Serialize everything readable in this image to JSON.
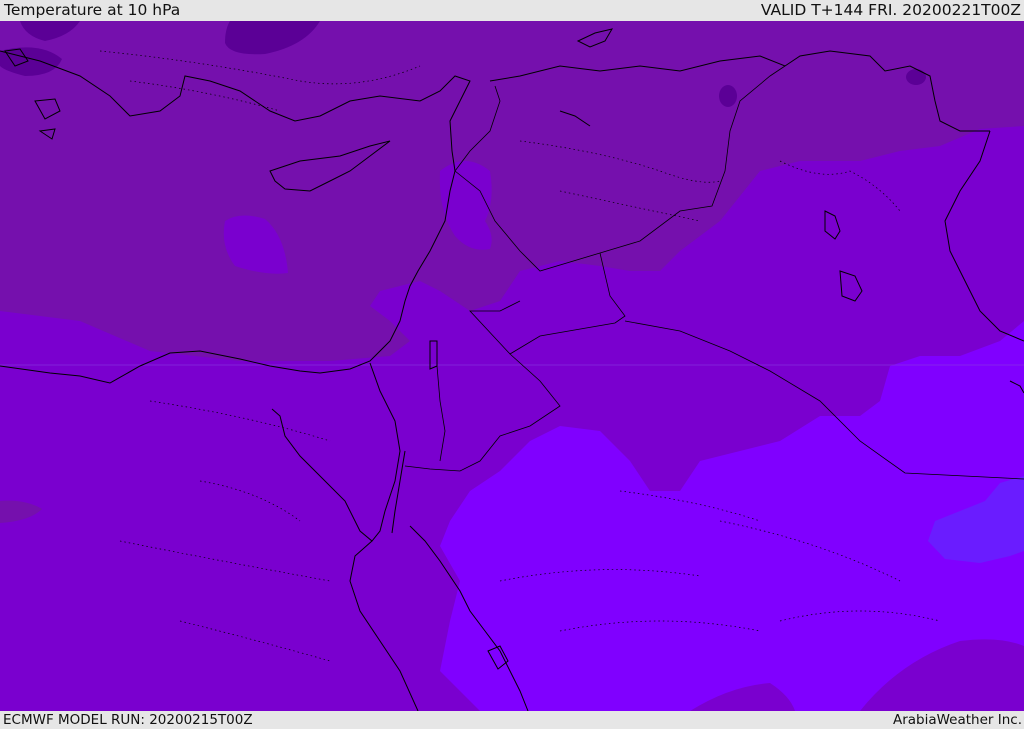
{
  "header": {
    "title": "Temperature at 10 hPa",
    "valid_time": "VALID T+144 FRI. 20200221T00Z"
  },
  "footer": {
    "model_run": "ECMWF MODEL RUN: 20200215T00Z",
    "credit": "ArabiaWeather Inc."
  },
  "colors": {
    "coldest": "#5b0096",
    "cold": "#7510ad",
    "mid": "#7a00cf",
    "warm": "#8000ff",
    "warmest": "#6a1cff",
    "land_border": "#000000",
    "background_bar": "#e6e6e6"
  }
}
